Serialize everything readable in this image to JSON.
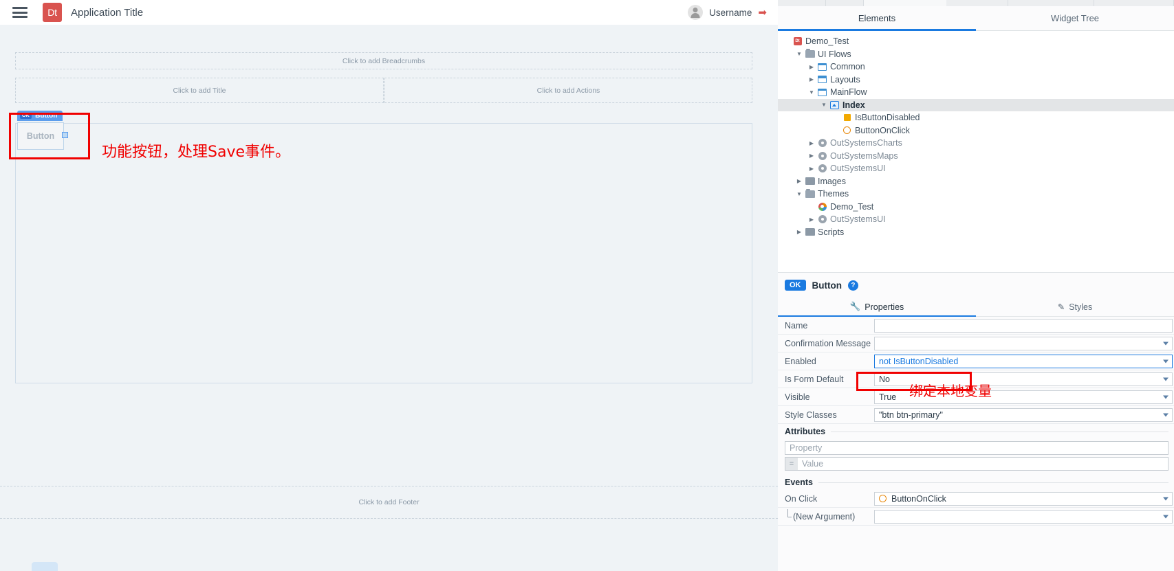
{
  "preview": {
    "header": {
      "menu_icon": "hamburger-icon",
      "logo_text": "Dt",
      "title": "Application Title",
      "username": "Username",
      "logout_icon": "logout-icon"
    },
    "placeholders": {
      "breadcrumbs": "Click to add Breadcrumbs",
      "title": "Click to add Title",
      "actions": "Click to add Actions",
      "footer": "Click to add Footer"
    },
    "widget": {
      "tag_badge": "OK",
      "tag_label": "Button",
      "button_label": "Button"
    },
    "annotation": "功能按钮，处理Save事件。"
  },
  "ide": {
    "panel_tabs": [
      {
        "label": "Elements",
        "active": true
      },
      {
        "label": "Widget Tree",
        "active": false
      }
    ],
    "tree": [
      {
        "label": "Demo_Test",
        "depth": 0,
        "twist": "none",
        "icon": "module-icon",
        "selected": false,
        "muted": false
      },
      {
        "label": "UI Flows",
        "depth": 1,
        "twist": "open",
        "icon": "folder-open-icon",
        "selected": false,
        "muted": false
      },
      {
        "label": "Common",
        "depth": 2,
        "twist": "closed",
        "icon": "flow-icon",
        "selected": false,
        "muted": false
      },
      {
        "label": "Layouts",
        "depth": 2,
        "twist": "closed",
        "icon": "flow-icon",
        "selected": false,
        "muted": false
      },
      {
        "label": "MainFlow",
        "depth": 2,
        "twist": "open",
        "icon": "flow-icon",
        "selected": false,
        "muted": false
      },
      {
        "label": "Index",
        "depth": 3,
        "twist": "open",
        "icon": "screen-icon",
        "selected": true,
        "muted": false
      },
      {
        "label": "IsButtonDisabled",
        "depth": 4,
        "twist": "none",
        "icon": "variable-icon",
        "selected": false,
        "muted": false
      },
      {
        "label": "ButtonOnClick",
        "depth": 4,
        "twist": "none",
        "icon": "event-icon",
        "selected": false,
        "muted": false
      },
      {
        "label": "OutSystemsCharts",
        "depth": 2,
        "twist": "closed",
        "icon": "reference-icon",
        "selected": false,
        "muted": true
      },
      {
        "label": "OutSystemsMaps",
        "depth": 2,
        "twist": "closed",
        "icon": "reference-icon",
        "selected": false,
        "muted": true
      },
      {
        "label": "OutSystemsUI",
        "depth": 2,
        "twist": "closed",
        "icon": "reference-icon",
        "selected": false,
        "muted": true
      },
      {
        "label": "Images",
        "depth": 1,
        "twist": "closed",
        "icon": "folder-icon",
        "selected": false,
        "muted": false
      },
      {
        "label": "Themes",
        "depth": 1,
        "twist": "open",
        "icon": "folder-open-icon",
        "selected": false,
        "muted": false
      },
      {
        "label": "Demo_Test",
        "depth": 2,
        "twist": "none",
        "icon": "theme-icon",
        "selected": false,
        "muted": false
      },
      {
        "label": "OutSystemsUI",
        "depth": 2,
        "twist": "closed",
        "icon": "reference-icon",
        "selected": false,
        "muted": true
      },
      {
        "label": "Scripts",
        "depth": 1,
        "twist": "closed",
        "icon": "folder-icon",
        "selected": false,
        "muted": false
      }
    ],
    "inspector": {
      "badge": "OK",
      "title": "Button",
      "help": "?",
      "tabs": [
        {
          "label": "Properties",
          "icon": "wrench-icon",
          "active": true
        },
        {
          "label": "Styles",
          "icon": "brush-icon",
          "active": false
        }
      ],
      "properties": [
        {
          "label": "Name",
          "value": "",
          "placeholder": "",
          "kind": "text",
          "bound": false,
          "caret": false
        },
        {
          "label": "Confirmation Message",
          "value": "",
          "placeholder": "",
          "kind": "text",
          "bound": false,
          "caret": true
        },
        {
          "label": "Enabled",
          "value": "not IsButtonDisabled",
          "placeholder": "",
          "kind": "expr",
          "bound": true,
          "caret": true
        },
        {
          "label": "Is Form Default",
          "value": "No",
          "placeholder": "",
          "kind": "lit",
          "bound": false,
          "caret": true
        },
        {
          "label": "Visible",
          "value": "True",
          "placeholder": "",
          "kind": "lit",
          "bound": false,
          "caret": true
        },
        {
          "label": "Style Classes",
          "value": "\"btn btn-primary\"",
          "placeholder": "",
          "kind": "lit",
          "bound": false,
          "caret": true
        }
      ],
      "attributes": {
        "heading": "Attributes",
        "property_placeholder": "Property",
        "value_placeholder": "Value",
        "eq_symbol": "="
      },
      "events": {
        "heading": "Events",
        "rows": [
          {
            "label": "On Click",
            "value": "ButtonOnClick",
            "icon": "event-icon",
            "indented": false
          },
          {
            "label": "(New Argument)",
            "value": "",
            "icon": "none",
            "indented": true
          }
        ]
      }
    },
    "annotation": "绑定本地变量"
  },
  "colors": {
    "brand_red": "#d9534f",
    "accent_blue": "#1a7ae0",
    "annotation_red": "#f00000",
    "variable_orange": "#f2a900",
    "canvas_bg": "#eff3f6"
  }
}
